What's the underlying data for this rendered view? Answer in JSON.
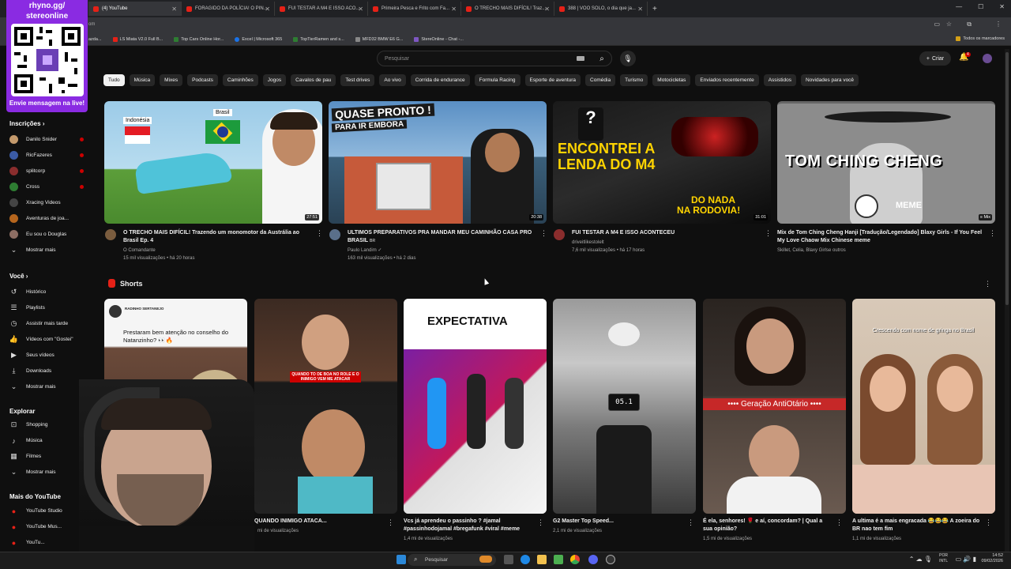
{
  "browser": {
    "tabs": [
      {
        "label": "(4) YouTube",
        "active": true
      },
      {
        "label": "FORAGIDO DA POLÍCIA! O PIN...",
        "active": false
      },
      {
        "label": "FUI TESTAR A M4 E ISSO ACO...",
        "active": false
      },
      {
        "label": "Primeira Pesca e Frito com Fa...",
        "active": false
      },
      {
        "label": "O TRECHO MAIS DIFÍCIL! Traz...",
        "active": false
      },
      {
        "label": "388 | VOO SOLO, o dia que ja...",
        "active": false
      }
    ],
    "address_fragment": "om",
    "bookmarks": [
      "LS Miata V2.0 Full B...",
      "Top Cars Online Hor...",
      "Excel | Microsoft 365",
      "TopTierRamen and s...",
      "MFD32 BMW E6 G...",
      "StereOnline - Chat -..."
    ],
    "bookmark_prefix": "azda...",
    "all_bookmarks": "Todos os marcadores"
  },
  "overlay": {
    "title_line1": "rhyno.gg/",
    "title_line2": "stereonline",
    "cta": "Envie mensagem na live!"
  },
  "header": {
    "search_placeholder": "Pesquisar",
    "create_label": "Criar",
    "notifications_count": "4"
  },
  "sidebar": {
    "subscriptions_title": "Inscrições",
    "subscriptions": [
      {
        "name": "Danilo Snider",
        "color": "#c49a6c"
      },
      {
        "name": "RicFazeres",
        "color": "#3b5ba5"
      },
      {
        "name": "splitcorp",
        "color": "#8a2d2d"
      },
      {
        "name": "Cross",
        "color": "#2e7d32"
      },
      {
        "name": "Xracing Videos",
        "color": "#444444"
      },
      {
        "name": "Aventuras de joa...",
        "color": "#b5651d"
      },
      {
        "name": "Eu sou o Douglas",
        "color": "#8d6e63"
      }
    ],
    "show_more": "Mostrar mais",
    "you_title": "Você",
    "you_items": [
      {
        "label": "Histórico",
        "icon": "history-icon"
      },
      {
        "label": "Playlists",
        "icon": "playlist-icon"
      },
      {
        "label": "Assistir mais tarde",
        "icon": "clock-icon"
      },
      {
        "label": "Vídeos com \"Gostei\"",
        "icon": "like-icon"
      },
      {
        "label": "Seus vídeos",
        "icon": "video-icon"
      },
      {
        "label": "Downloads",
        "icon": "download-icon"
      },
      {
        "label": "Mostrar mais",
        "icon": "chevron-down-icon"
      }
    ],
    "explore_title": "Explorar",
    "explore_items": [
      {
        "label": "Shopping",
        "icon": "bag-icon"
      },
      {
        "label": "Música",
        "icon": "music-icon"
      },
      {
        "label": "Filmes",
        "icon": "film-icon"
      },
      {
        "label": "Mostrar mais",
        "icon": "chevron-down-icon"
      }
    ],
    "more_title": "Mais do YouTube",
    "more_items": [
      "YouTube Studio",
      "YouTube Mus...",
      "YouTu..."
    ]
  },
  "chips": [
    "Tudo",
    "Música",
    "Mixes",
    "Podcasts",
    "Caminhões",
    "Jogos",
    "Cavalos de pau",
    "Test drives",
    "Ao vivo",
    "Corrida de endurance",
    "Formula Racing",
    "Esporte de aventura",
    "Comédia",
    "Turismo",
    "Motocicletas",
    "Enviados recentemente",
    "Assistidos",
    "Novidades para você"
  ],
  "videos": [
    {
      "title": "O TRECHO MAIS DIFÍCIL! Trazendo um monomotor da Austrália ao Brasil Ep. 4",
      "channel": "O Comandante",
      "meta": "15 mil visualizações • há 20 horas",
      "duration": "27:51",
      "overlay1": "Indonésia",
      "overlay2": "Brasil",
      "avatar_color": "#7a5c3e"
    },
    {
      "title": "ULTIMOS PREPARATIVOS  PRA MANDAR MEU CAMINHÃO CASA PRO BRASIL",
      "badge": "BR",
      "channel": "Paulo Landim ✓",
      "meta": "163 mil visualizações • há 2 dias",
      "duration": "20:38",
      "overlay1": "QUASE PRONTO !",
      "overlay2": "PARA IR EMBORA",
      "avatar_color": "#5a6f8a"
    },
    {
      "title": "FUI TESTAR A M4 E ISSO ACONTECEU",
      "channel": "driveitlikestolelt",
      "meta": "7,6 mil visualizações • há 17 horas",
      "duration": "31:01",
      "overlay1": "ENCONTREI A",
      "overlay2": "LENDA DO M4",
      "overlay3": "DO NADA",
      "overlay4": "NA RODOVIA!",
      "avatar_color": "#8a2d2d"
    },
    {
      "title": "Mix de Tom Ching Cheng Hanji [Tradução/Legendado] Blaxy Girls - If You Feel My Love Chaow Mix Chinese meme",
      "channel": "Skillet, Celia, Blaxy Girlse outros",
      "meta": "",
      "duration": "Mix",
      "overlay1": "TOM CHING CHENG",
      "overlay2": "MEME",
      "avatar_color": ""
    }
  ],
  "shorts_title": "Shorts",
  "shorts": [
    {
      "title": "",
      "views": "",
      "overlay_top": "RADINHO SERTANEJO",
      "overlay_text": "Prestaram bem atenção no conselho do Natanzinho? 👀🔥"
    },
    {
      "title": "QUANDO INIMIGO ATACA...",
      "views": "mi de visualizações",
      "overlay_text": "QUANDO TO DE BOA NO ROLE E O INIMIGO VEM ME ATACAR"
    },
    {
      "title": "Vcs já aprendeu o passinho ? #jamal #passinhodojamal #bregafunk #viral #meme",
      "views": "1,4 mi de visualizações",
      "overlay_text": "EXPECTATIVA"
    },
    {
      "title": "G2 Master Top Speed...",
      "views": "2,1 mi de visualizações",
      "overlay_text": "05.1"
    },
    {
      "title": "É ela, senhores! 🌹 e aí, concordam? | Qual a sua opinião?",
      "views": "1,5 mi de visualizações",
      "overlay_text": "•••• Geração AntiOtário ••••"
    },
    {
      "title": "A ultima é a mais engracada 😂😂😂 A zoeira do BR nao tem fim",
      "views": "1,1 mi de visualizações",
      "overlay_text": "Crescendo com nome de gringa no Brasil"
    }
  ],
  "taskbar": {
    "search_placeholder": "Pesquisar",
    "lang1": "POR",
    "lang2": "INTL",
    "time": "14:52",
    "date": "09/02/2026"
  }
}
